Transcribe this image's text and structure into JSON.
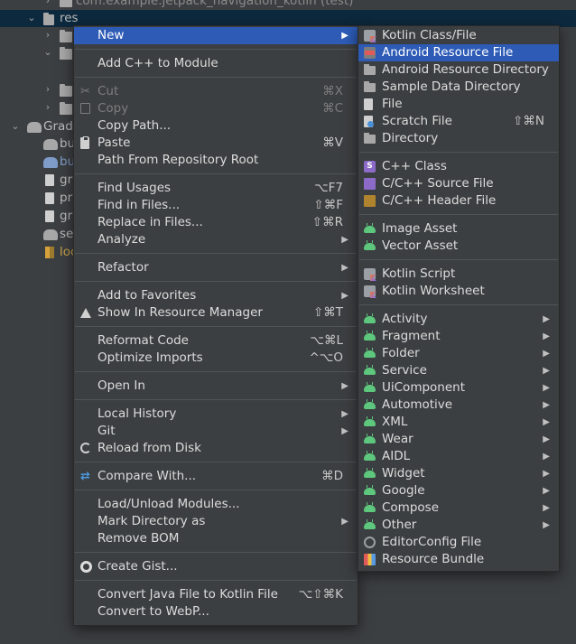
{
  "tree": {
    "rows": [
      {
        "label": "com.example.jetpack_navigation_kotlin (test)",
        "muted": true
      },
      {
        "label": "res"
      },
      {
        "label": "bu"
      },
      {
        "label": "bu"
      },
      {
        "label": "gr"
      },
      {
        "label": "pr"
      },
      {
        "label": "gr"
      },
      {
        "label": "set"
      },
      {
        "label": "loc"
      }
    ],
    "gradle_label": "Gradle"
  },
  "menu": {
    "items": [
      {
        "label": "New",
        "shortcut": "",
        "submenu": true,
        "highlighted": true
      },
      {
        "label": "Add C++ to Module",
        "shortcut": ""
      },
      {
        "label": "Cut",
        "shortcut": "⌘X",
        "disabled": true
      },
      {
        "label": "Copy",
        "shortcut": "⌘C",
        "disabled": true
      },
      {
        "label": "Copy Path...",
        "shortcut": ""
      },
      {
        "label": "Paste",
        "shortcut": "⌘V"
      },
      {
        "label": "Path From Repository Root",
        "shortcut": ""
      },
      {
        "label": "Find Usages",
        "shortcut": "⌥F7"
      },
      {
        "label": "Find in Files...",
        "shortcut": "⇧⌘F"
      },
      {
        "label": "Replace in Files...",
        "shortcut": "⇧⌘R"
      },
      {
        "label": "Analyze",
        "shortcut": "",
        "submenu": true
      },
      {
        "label": "Refactor",
        "shortcut": "",
        "submenu": true
      },
      {
        "label": "Add to Favorites",
        "shortcut": "",
        "submenu": true
      },
      {
        "label": "Show In Resource Manager",
        "shortcut": "⇧⌘T"
      },
      {
        "label": "Reformat Code",
        "shortcut": "⌥⌘L"
      },
      {
        "label": "Optimize Imports",
        "shortcut": "^⌥O"
      },
      {
        "label": "Open In",
        "shortcut": "",
        "submenu": true
      },
      {
        "label": "Local History",
        "shortcut": "",
        "submenu": true
      },
      {
        "label": "Git",
        "shortcut": "",
        "submenu": true
      },
      {
        "label": "Reload from Disk",
        "shortcut": ""
      },
      {
        "label": "Compare With...",
        "shortcut": "⌘D"
      },
      {
        "label": "Load/Unload Modules...",
        "shortcut": ""
      },
      {
        "label": "Mark Directory as",
        "shortcut": "",
        "submenu": true
      },
      {
        "label": "Remove BOM",
        "shortcut": ""
      },
      {
        "label": "Create Gist...",
        "shortcut": ""
      },
      {
        "label": "Convert Java File to Kotlin File",
        "shortcut": "⌥⇧⌘K"
      },
      {
        "label": "Convert to WebP...",
        "shortcut": ""
      }
    ]
  },
  "submenu": {
    "items": [
      {
        "label": "Kotlin Class/File",
        "shortcut": ""
      },
      {
        "label": "Android Resource File",
        "shortcut": "",
        "highlighted": true
      },
      {
        "label": "Android Resource Directory",
        "shortcut": ""
      },
      {
        "label": "Sample Data Directory",
        "shortcut": ""
      },
      {
        "label": "File",
        "shortcut": ""
      },
      {
        "label": "Scratch File",
        "shortcut": "⇧⌘N"
      },
      {
        "label": "Directory",
        "shortcut": ""
      },
      {
        "label": "C++ Class",
        "shortcut": ""
      },
      {
        "label": "C/C++ Source File",
        "shortcut": ""
      },
      {
        "label": "C/C++ Header File",
        "shortcut": ""
      },
      {
        "label": "Image Asset",
        "shortcut": ""
      },
      {
        "label": "Vector Asset",
        "shortcut": ""
      },
      {
        "label": "Kotlin Script",
        "shortcut": ""
      },
      {
        "label": "Kotlin Worksheet",
        "shortcut": ""
      },
      {
        "label": "Activity",
        "shortcut": "",
        "submenu": true
      },
      {
        "label": "Fragment",
        "shortcut": "",
        "submenu": true
      },
      {
        "label": "Folder",
        "shortcut": "",
        "submenu": true
      },
      {
        "label": "Service",
        "shortcut": "",
        "submenu": true
      },
      {
        "label": "UiComponent",
        "shortcut": "",
        "submenu": true
      },
      {
        "label": "Automotive",
        "shortcut": "",
        "submenu": true
      },
      {
        "label": "XML",
        "shortcut": "",
        "submenu": true
      },
      {
        "label": "Wear",
        "shortcut": "",
        "submenu": true
      },
      {
        "label": "AIDL",
        "shortcut": "",
        "submenu": true
      },
      {
        "label": "Widget",
        "shortcut": "",
        "submenu": true
      },
      {
        "label": "Google",
        "shortcut": "",
        "submenu": true
      },
      {
        "label": "Compose",
        "shortcut": "",
        "submenu": true
      },
      {
        "label": "Other",
        "shortcut": "",
        "submenu": true
      },
      {
        "label": "EditorConfig File",
        "shortcut": ""
      },
      {
        "label": "Resource Bundle",
        "shortcut": ""
      }
    ]
  },
  "colors": {
    "highlight": "#2d5bb6",
    "menu_bg": "#3c3f41",
    "separator": "#515456"
  }
}
